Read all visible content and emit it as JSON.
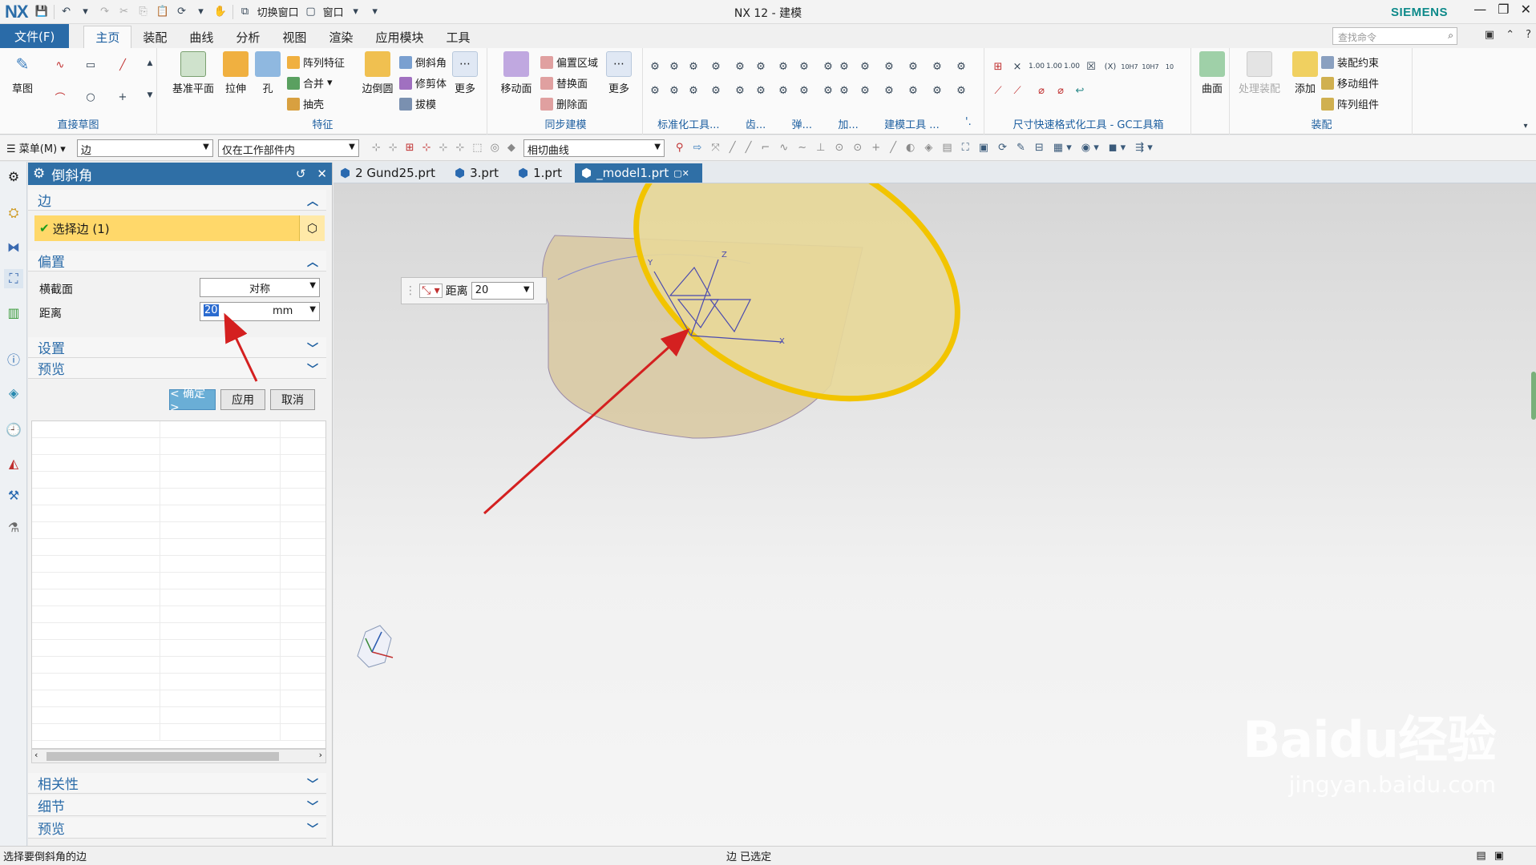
{
  "app": {
    "logo": "NX",
    "title": "NX 12 - 建模",
    "brand": "SIEMENS",
    "quick_access": {
      "switch_window": "切换窗口",
      "window": "窗口"
    }
  },
  "ribbon_tabs": {
    "file": "文件(F)",
    "tabs": [
      "主页",
      "装配",
      "曲线",
      "分析",
      "视图",
      "渲染",
      "应用模块",
      "工具"
    ],
    "active": "主页",
    "search_placeholder": "查找命令"
  },
  "ribbon": {
    "sketch": "草图",
    "group_direct_sketch": "直接草图",
    "datum_plane": "基准平面",
    "extrude": "拉伸",
    "hole": "孔",
    "pattern_feature": "阵列特征",
    "unite": "合并",
    "shell": "抽壳",
    "edge_blend": "边倒圆",
    "chamfer": "倒斜角",
    "trim_body": "修剪体",
    "draft": "拔模",
    "more": "更多",
    "group_feature": "特征",
    "move_face": "移动面",
    "offset_region": "偏置区域",
    "replace_face": "替换面",
    "delete_face": "删除面",
    "group_sync": "同步建模",
    "more2": "更多",
    "group_standard": "标准化工具...",
    "group_gear": "齿...",
    "group_spring": "弹...",
    "group_add": "加...",
    "group_model_tools": "建模工具 ...",
    "group_dot": "'.",
    "group_gc": "尺寸快速格式化工具 - GC工具箱",
    "surface": "曲面",
    "process_assembly": "处理装配",
    "add": "添加",
    "assembly_constraint": "装配约束",
    "move_component": "移动组件",
    "pattern_component": "阵列组件",
    "group_assembly": "装配"
  },
  "selbar": {
    "menu": "菜单(M)",
    "filter_type": "边",
    "scope": "仅在工作部件内",
    "curve_rule": "相切曲线"
  },
  "dialog": {
    "title": "倒斜角",
    "section_edge": "边",
    "select_edge": "选择边 (1)",
    "section_offset": "偏置",
    "cross_section_label": "横截面",
    "cross_section_value": "对称",
    "distance_label": "距离",
    "distance_value": "20",
    "distance_unit": "mm",
    "section_settings": "设置",
    "section_preview": "预览",
    "ok": "< 确定 >",
    "apply": "应用",
    "cancel": "取消",
    "section_related": "相关性",
    "section_detail": "细节",
    "section_preview2": "预览"
  },
  "doc_tabs": [
    {
      "label": "2 Gund25.prt"
    },
    {
      "label": "3.prt"
    },
    {
      "label": "1.prt"
    },
    {
      "label": "_model1.prt"
    }
  ],
  "float_input": {
    "label": "距离",
    "value": "20"
  },
  "status": {
    "prompt": "选择要倒斜角的边",
    "message": "边 已选定"
  },
  "watermark": {
    "main": "Baidu经验",
    "sub": "jingyan.baidu.com"
  },
  "colors": {
    "accent": "#2a6ba8",
    "selected_row": "#ffd86a",
    "brand": "#0e8a8a",
    "cylinder": "#d8c8a0",
    "highlight_edge": "#f2c400",
    "arrow": "#d42020"
  }
}
